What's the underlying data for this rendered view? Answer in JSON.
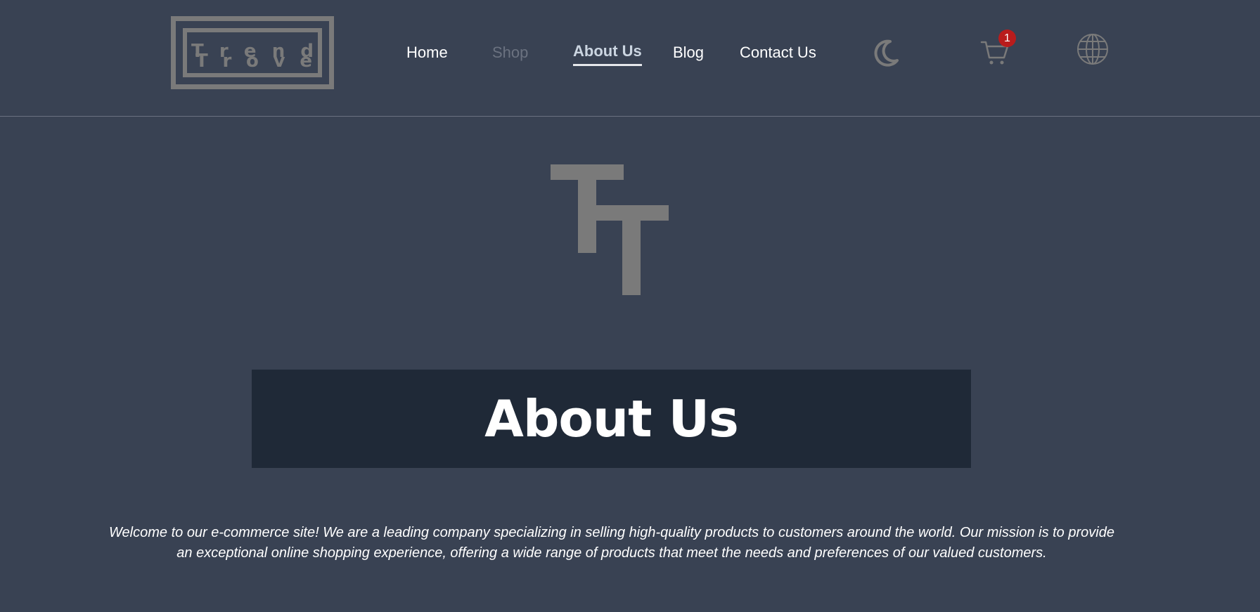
{
  "logo": {
    "line1": [
      "T",
      "r",
      "e",
      "n",
      "d"
    ],
    "line2": [
      "T",
      "r",
      "o",
      "v",
      "e"
    ],
    "color": "#7a7a7a"
  },
  "nav": {
    "items": [
      {
        "label": "Home",
        "state": "normal"
      },
      {
        "label": "Shop",
        "state": "muted"
      },
      {
        "label": "About Us",
        "state": "active"
      },
      {
        "label": "Blog",
        "state": "normal"
      },
      {
        "label": "Contact Us",
        "state": "normal"
      }
    ]
  },
  "header_icons": {
    "theme_toggle": "moon-icon",
    "cart": "cart-icon",
    "language": "globe-icon",
    "cart_count": "1"
  },
  "brand_mark": {
    "icon": "tt-monogram",
    "color": "#7a7a7a"
  },
  "page": {
    "title": "About Us",
    "intro_line1": "Welcome to our e-commerce site! We are a leading company specializing in selling high-quality products to customers around the world. Our mission is to provide",
    "intro_line2": "an exceptional online shopping experience, offering a wide range of products that meet the needs and preferences of our valued customers."
  },
  "colors": {
    "background": "#394253",
    "banner": "#1f2937",
    "badge": "#b91c1c",
    "muted": "#6b7280"
  }
}
